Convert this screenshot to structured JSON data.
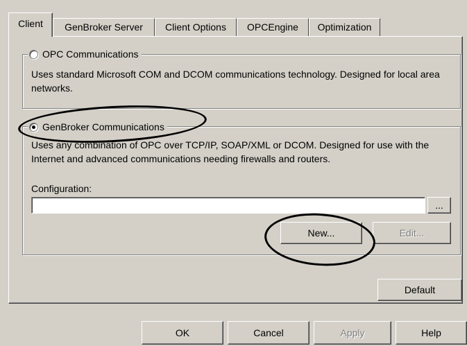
{
  "tabs": [
    {
      "label": "Client"
    },
    {
      "label": "GenBroker Server"
    },
    {
      "label": "Client Options"
    },
    {
      "label": "OPCEngine"
    },
    {
      "label": "Optimization"
    }
  ],
  "opc_group": {
    "option_label": "OPC Communications",
    "selected": false,
    "description": "Uses standard Microsoft COM and DCOM communications technology. Designed for local area networks."
  },
  "genbroker_group": {
    "option_label": "GenBroker Communications",
    "selected": true,
    "description": "Uses any combination of OPC over TCP/IP, SOAP/XML or DCOM. Designed for use with the Internet and advanced communications needing firewalls and routers.",
    "configuration_label": "Configuration:",
    "configuration_value": "",
    "browse_label": "...",
    "new_label": "New...",
    "edit_label": "Edit..."
  },
  "default_label": "Default",
  "dialog_buttons": {
    "ok": "OK",
    "cancel": "Cancel",
    "apply": "Apply",
    "help": "Help"
  }
}
